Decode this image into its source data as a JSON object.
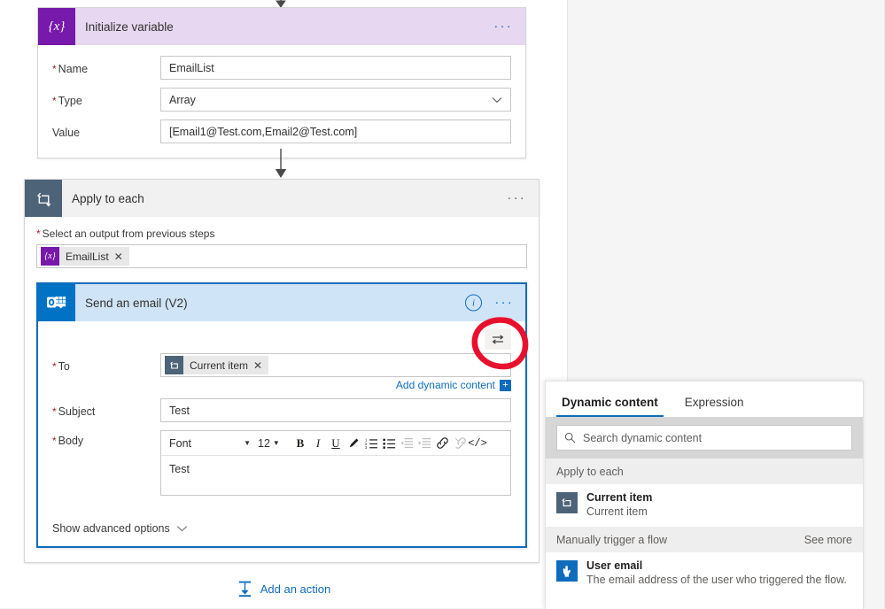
{
  "canvas": {
    "init_variable": {
      "icon": "variable-braces-icon",
      "title": "Initialize variable",
      "menu": "···",
      "fields": [
        {
          "label": "Name",
          "value": "EmailList"
        },
        {
          "label": "Type",
          "value": "Array"
        },
        {
          "label": "Value",
          "value": "[Email1@Test.com,Email2@Test.com]"
        }
      ],
      "name_label": "Name",
      "name_value": "EmailList",
      "type_label": "Type",
      "type_value": "Array",
      "value_label": "Value",
      "value_value": "[Email1@Test.com,Email2@Test.com]",
      "header_color": "#e7d7f0",
      "icon_color": "#7719aa"
    },
    "apply_to_each": {
      "icon": "loop-icon",
      "title": "Apply to each",
      "menu": "···",
      "select_output_label": "Select an output from previous steps",
      "token": {
        "label": "EmailList",
        "icon": "variable-braces-icon",
        "remove": "✕"
      },
      "header_color": "#f1f1f1",
      "icon_color": "#4d6378"
    },
    "send_email": {
      "icon": "outlook-icon",
      "title": "Send an email (V2)",
      "info": "i",
      "menu": "···",
      "swap_icon": "swap-arrows-icon",
      "to_label": "To",
      "to_token": {
        "label": "Current item",
        "icon": "loop-icon",
        "remove": "✕"
      },
      "add_dynamic_content": "Add dynamic content",
      "add_dynamic_plus": "+",
      "subject_label": "Subject",
      "subject_value": "Test",
      "body_label": "Body",
      "body_value": "Test",
      "toolbar": {
        "font_name": "Font",
        "font_size": "12",
        "bold": "B",
        "italic": "I",
        "underline": "U",
        "font_color": "font-color-pen-icon",
        "numbered_list": "numbered-list-icon",
        "bulleted_list": "bulleted-list-icon",
        "decrease_indent": "decrease-indent-icon",
        "increase_indent": "increase-indent-icon",
        "insert_link": "link-icon",
        "remove_link": "unlink-icon",
        "code_view": "</>"
      },
      "show_advanced": "Show advanced options",
      "header_color": "#cfe4f7",
      "border_color": "#0f6cbd",
      "icon_color": "#0072c6"
    },
    "add_action": {
      "label": "Add an action",
      "icon": "add-action-icon"
    },
    "annotation": {
      "shape": "red-circle-highlight",
      "color": "#e8112d"
    }
  },
  "dynamic_content_panel": {
    "tabs": [
      {
        "label": "Dynamic content",
        "active": true
      },
      {
        "label": "Expression",
        "active": false
      }
    ],
    "tab_dynamic": "Dynamic content",
    "tab_expression": "Expression",
    "search": {
      "placeholder": "Search dynamic content",
      "value": "",
      "icon": "search-icon"
    },
    "groups": [
      {
        "title": "Apply to each",
        "see_more": "",
        "items": [
          {
            "title": "Current item",
            "desc": "Current item",
            "icon": "loop-icon",
            "icon_color": "#4d6378"
          }
        ]
      },
      {
        "title": "Manually trigger a flow",
        "see_more": "See more",
        "items": [
          {
            "title": "User email",
            "desc": "The email address of the user who triggered the flow.",
            "icon": "manual-trigger-hand-icon",
            "icon_color": "#0f6cbd"
          }
        ]
      }
    ],
    "group1_title": "Apply to each",
    "group1_item_title": "Current item",
    "group1_item_desc": "Current item",
    "group2_title": "Manually trigger a flow",
    "group2_see_more": "See more",
    "group2_item_title": "User email",
    "group2_item_desc": "The email address of the user who triggered the flow."
  }
}
